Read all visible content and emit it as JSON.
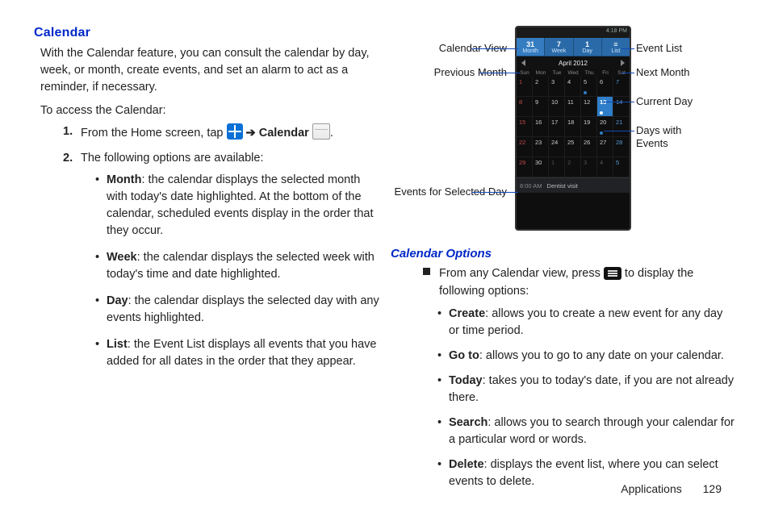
{
  "heading": "Calendar",
  "intro": "With the Calendar feature, you can consult the calendar by day, week, or month, create events, and set an alarm to act as a reminder, if necessary.",
  "access": "To access the Calendar:",
  "step1_num": "1.",
  "step1_pre": "From the Home screen, tap ",
  "step1_arrow": "➔",
  "step1_cal": "Calendar",
  "step1_post": ".",
  "step2_num": "2.",
  "step2": "The following options are available:",
  "views": {
    "month": {
      "label": "Month",
      "desc": ": the calendar displays the selected month with today's date highlighted. At the bottom of the calendar, scheduled events display in the order that they occur."
    },
    "week": {
      "label": "Week",
      "desc": ": the calendar displays the selected week with today's time and date highlighted."
    },
    "day": {
      "label": "Day",
      "desc": ": the calendar displays the selected day with any events highlighted."
    },
    "list": {
      "label": "List",
      "desc": ": the Event List displays all events that you have added for all dates in the order that they appear."
    }
  },
  "callouts": {
    "calendar_view": "Calendar View",
    "previous_month": "Previous Month",
    "events_for": "Events for Selected Day",
    "event_list": "Event List",
    "next_month": "Next Month",
    "current_day": "Current Day",
    "days_with_events": "Days with Events"
  },
  "phone": {
    "time": "4:18 PM",
    "tabs": {
      "month_num": "31",
      "month": "Month",
      "week_num": "7",
      "week": "Week",
      "day_num": "1",
      "day": "Day",
      "list": "List"
    },
    "month_label": "April 2012",
    "dow": [
      "Sun",
      "Mon",
      "Tue",
      "Wed",
      "Thu",
      "Fri",
      "Sat"
    ],
    "event_time": "8:00 AM",
    "event_text": "Dentist visit"
  },
  "options_heading": "Calendar Options",
  "options_intro_pre": "From any Calendar view, press ",
  "options_intro_post": " to display the following options:",
  "options": {
    "create": {
      "label": "Create",
      "desc": ": allows you to create a new event for any day or time period."
    },
    "goto": {
      "label": "Go to",
      "desc": ": allows you to go to any date on your calendar."
    },
    "today": {
      "label": "Today",
      "desc": ": takes you to today's date, if you are not already there."
    },
    "search": {
      "label": "Search",
      "desc": ": allows you to search through your calendar for a particular word or words."
    },
    "delete": {
      "label": "Delete",
      "desc": ": displays the event list, where you can select events to delete."
    }
  },
  "footer": {
    "section": "Applications",
    "page": "129"
  }
}
